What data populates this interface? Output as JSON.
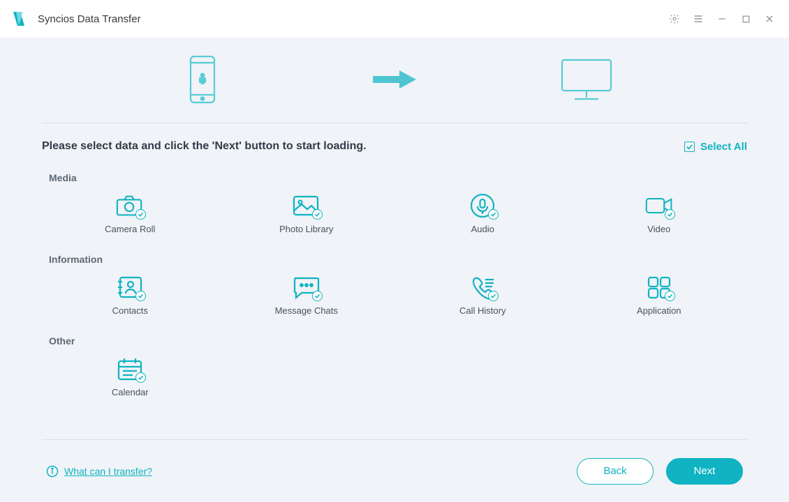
{
  "app": {
    "title": "Syncios Data Transfer"
  },
  "instruction": "Please select data and click the 'Next' button to start loading.",
  "select_all": {
    "label": "Select All",
    "checked": true
  },
  "sections": {
    "media": {
      "title": "Media",
      "items": [
        {
          "icon": "camera-roll-icon",
          "label": "Camera Roll",
          "checked": true
        },
        {
          "icon": "photo-library-icon",
          "label": "Photo Library",
          "checked": true
        },
        {
          "icon": "audio-icon",
          "label": "Audio",
          "checked": true
        },
        {
          "icon": "video-icon",
          "label": "Video",
          "checked": true
        }
      ]
    },
    "information": {
      "title": "Information",
      "items": [
        {
          "icon": "contacts-icon",
          "label": "Contacts",
          "checked": true
        },
        {
          "icon": "message-chats-icon",
          "label": "Message Chats",
          "checked": true
        },
        {
          "icon": "call-history-icon",
          "label": "Call History",
          "checked": true
        },
        {
          "icon": "application-icon",
          "label": "Application",
          "checked": true
        }
      ]
    },
    "other": {
      "title": "Other",
      "items": [
        {
          "icon": "calendar-icon",
          "label": "Calendar",
          "checked": true
        }
      ]
    }
  },
  "help": {
    "label": "What can I transfer?"
  },
  "footer": {
    "back": "Back",
    "next": "Next"
  },
  "colors": {
    "accent": "#0fb3c2",
    "text": "#46525e"
  }
}
